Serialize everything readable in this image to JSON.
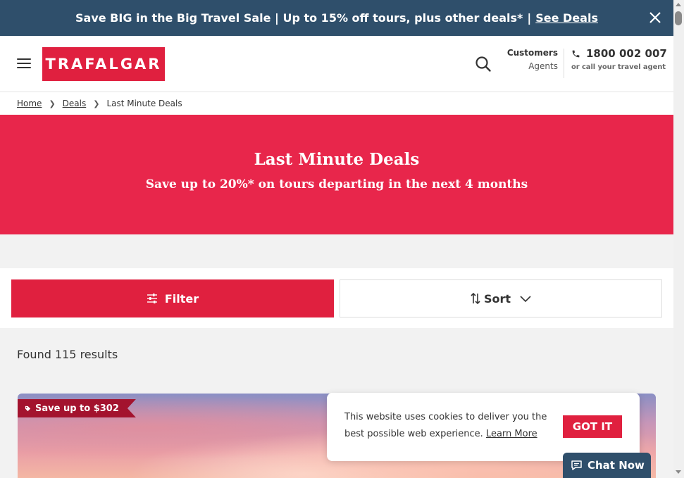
{
  "promo": {
    "text": "Save BIG in the Big Travel Sale | Up to 15% off tours, plus other deals*",
    "separator": "|",
    "link": "See Deals"
  },
  "header": {
    "logo": "TRAFALGAR",
    "customers": "Customers",
    "agents": "Agents",
    "phone": "1800 002 007",
    "phone_sub": "or call your travel agent"
  },
  "breadcrumb": {
    "home": "Home",
    "deals": "Deals",
    "current": "Last Minute Deals"
  },
  "hero": {
    "title": "Last Minute Deals",
    "subtitle": "Save up to 20%* on tours departing in the next 4 months"
  },
  "controls": {
    "filter": "Filter",
    "sort": "Sort"
  },
  "results": {
    "text": "Found 115 results"
  },
  "card": {
    "badge": "Save up to $302"
  },
  "cookie": {
    "text": "This website uses cookies to deliver you the best possible web experience.",
    "learn_more": "Learn More",
    "button": "GOT IT"
  },
  "chat": {
    "label": "Chat Now"
  },
  "colors": {
    "brand": "#e0203f",
    "hero": "#e8264b",
    "navy": "#2f4f6b",
    "badge": "#a3132e"
  }
}
